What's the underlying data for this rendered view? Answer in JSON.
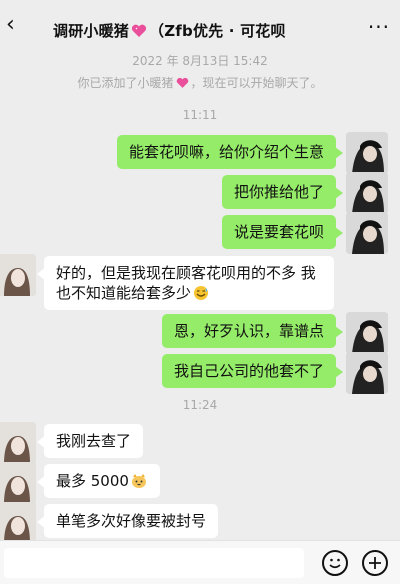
{
  "header": {
    "title_prefix": "调研小暖猪",
    "title_suffix": "（Zfb优先 · 可花呗",
    "back_glyph": "‹",
    "more_glyph": "···"
  },
  "system": {
    "date": "2022 年 8月13日 15:42",
    "added_prefix": "你已添加了小暖猪",
    "added_suffix": "，现在可以开始聊天了。",
    "time1": "11:11",
    "time2": "11:24"
  },
  "messages": [
    {
      "side": "me",
      "text": "能套花呗嘛，给你介绍个生意"
    },
    {
      "side": "me",
      "text": "把你推给他了"
    },
    {
      "side": "me",
      "text": "说是要套花呗"
    },
    {
      "side": "them",
      "text": "好的，但是我现在顾客花呗用的不多 我也不知道能给套多少"
    },
    {
      "side": "me",
      "text": "恩，好歹认识，靠谱点"
    },
    {
      "side": "me",
      "text": "我自己公司的他套不了"
    },
    {
      "side": "them",
      "text": "我刚去查了"
    },
    {
      "side": "them",
      "text": "最多 5000"
    },
    {
      "side": "them",
      "text": "单笔多次好像要被封号"
    }
  ],
  "icons": {
    "heart": "sparkling-heart-icon",
    "sweat": "sweat-smile-emoji",
    "cat": "cat-emoji",
    "smiley": "emoji-smiley-icon",
    "plus": "plus-circle-icon"
  },
  "colors": {
    "background": "#ededed",
    "my_bubble": "#95ec69",
    "their_bubble": "#ffffff",
    "system_text": "#a8a8a8"
  }
}
